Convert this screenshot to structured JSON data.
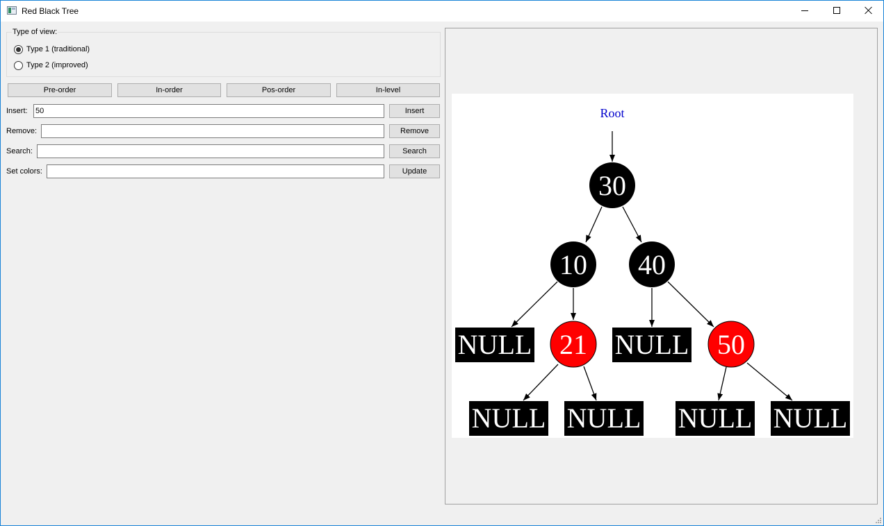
{
  "window": {
    "title": "Red Black Tree"
  },
  "view_group": {
    "title": "Type of view:",
    "options": [
      {
        "label": "Type 1 (traditional)",
        "checked": true
      },
      {
        "label": "Type 2 (improved)",
        "checked": false
      }
    ]
  },
  "traversal_buttons": [
    "Pre-order",
    "In-order",
    "Pos-order",
    "In-level"
  ],
  "rows": {
    "insert": {
      "label": "Insert:",
      "value": "50",
      "button": "Insert"
    },
    "remove": {
      "label": "Remove:",
      "value": "",
      "button": "Remove"
    },
    "search": {
      "label": "Search:",
      "value": "",
      "button": "Search"
    },
    "colors": {
      "label": "Set colors:",
      "value": "",
      "button": "Update"
    }
  },
  "tree": {
    "root_label": "Root",
    "colors": {
      "black": "#000000",
      "red": "#ff0000",
      "root_label": "#0000cc",
      "node_text": "#ffffff"
    },
    "nodes": {
      "n30": {
        "label": "30",
        "color": "black"
      },
      "n10": {
        "label": "10",
        "color": "black"
      },
      "n40": {
        "label": "40",
        "color": "black"
      },
      "n21": {
        "label": "21",
        "color": "red"
      },
      "n50": {
        "label": "50",
        "color": "red"
      }
    },
    "null_label": "NULL"
  }
}
